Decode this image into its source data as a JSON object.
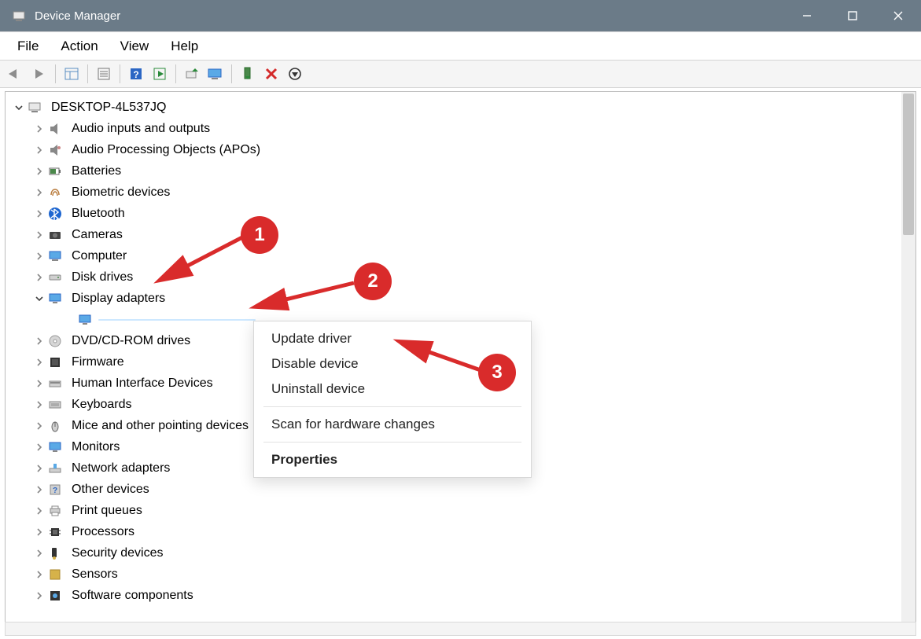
{
  "window": {
    "title": "Device Manager"
  },
  "menu": {
    "items": [
      "File",
      "Action",
      "View",
      "Help"
    ]
  },
  "tree": {
    "root": "DESKTOP-4L537JQ",
    "categories": [
      {
        "label": "Audio inputs and outputs",
        "expanded": false
      },
      {
        "label": "Audio Processing Objects (APOs)",
        "expanded": false
      },
      {
        "label": "Batteries",
        "expanded": false
      },
      {
        "label": "Biometric devices",
        "expanded": false
      },
      {
        "label": "Bluetooth",
        "expanded": false
      },
      {
        "label": "Cameras",
        "expanded": false
      },
      {
        "label": "Computer",
        "expanded": false
      },
      {
        "label": "Disk drives",
        "expanded": false
      },
      {
        "label": "Display adapters",
        "expanded": true,
        "children": [
          {
            "label": "",
            "selected": true
          }
        ]
      },
      {
        "label": "DVD/CD-ROM drives",
        "expanded": false
      },
      {
        "label": "Firmware",
        "expanded": false
      },
      {
        "label": "Human Interface Devices",
        "expanded": false
      },
      {
        "label": "Keyboards",
        "expanded": false
      },
      {
        "label": "Mice and other pointing devices",
        "expanded": false
      },
      {
        "label": "Monitors",
        "expanded": false
      },
      {
        "label": "Network adapters",
        "expanded": false
      },
      {
        "label": "Other devices",
        "expanded": false
      },
      {
        "label": "Print queues",
        "expanded": false
      },
      {
        "label": "Processors",
        "expanded": false
      },
      {
        "label": "Security devices",
        "expanded": false
      },
      {
        "label": "Sensors",
        "expanded": false
      },
      {
        "label": "Software components",
        "expanded": false
      }
    ]
  },
  "context_menu": {
    "items": [
      {
        "label": "Update driver",
        "bold": false
      },
      {
        "label": "Disable device",
        "bold": false
      },
      {
        "label": "Uninstall device",
        "bold": false
      },
      {
        "sep": true
      },
      {
        "label": "Scan for hardware changes",
        "bold": false
      },
      {
        "sep": true
      },
      {
        "label": "Properties",
        "bold": true
      }
    ]
  },
  "annotations": {
    "badge1": "1",
    "badge2": "2",
    "badge3": "3"
  },
  "colors": {
    "titlebar": "#6b7b88",
    "selection": "#cde8ff",
    "badge": "#d92b2b"
  }
}
